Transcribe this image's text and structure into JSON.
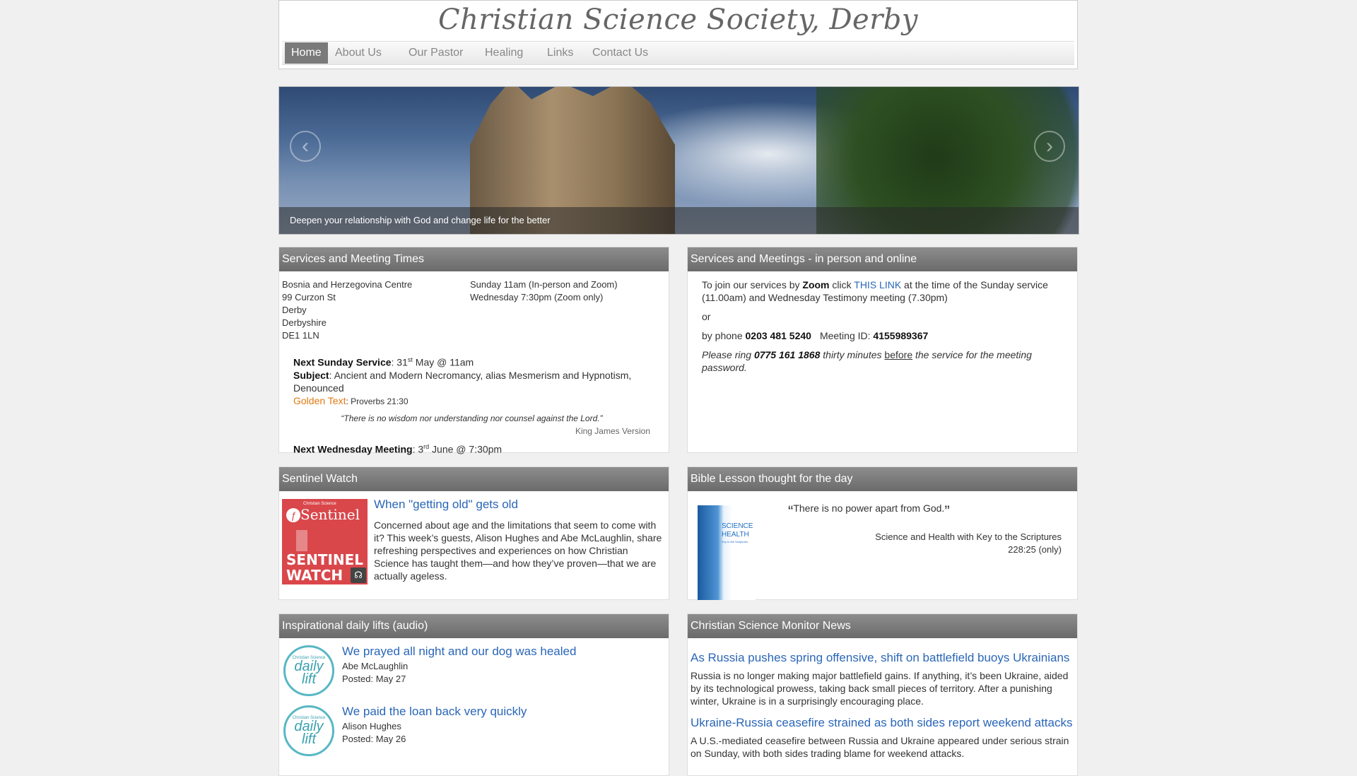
{
  "site": {
    "title": "Christian Science Society, Derby"
  },
  "nav": [
    {
      "label": "Home"
    },
    {
      "label": "About Us"
    },
    {
      "label": "Our Pastor"
    },
    {
      "label": "Healing"
    },
    {
      "label": "Links"
    },
    {
      "label": "Contact Us"
    }
  ],
  "hero": {
    "caption": "Deepen your relationship with God and change life for the better"
  },
  "services_times": {
    "heading": "Services and Meeting Times",
    "address": [
      "Bosnia and Herzegovina Centre",
      "99 Curzon St",
      "Derby",
      "Derbyshire",
      "DE1 1LN"
    ],
    "times": [
      "Sunday 11am (In-person and Zoom)",
      "Wednesday 7:30pm (Zoom only)"
    ],
    "next_sunday_label": "Next Sunday Service",
    "next_sunday_pre": ": 31",
    "next_sunday_sup": "st",
    "next_sunday_post": " May @ 11am",
    "subject_label": "Subject",
    "subject_value": ": Ancient and Modern Necromancy, alias Mesmerism and Hypnotism, Denounced",
    "golden_label": "Golden Text",
    "golden_ref": ": Proverbs 21:30",
    "golden_quote": "“There is no wisdom nor understanding nor counsel against the Lord.”",
    "golden_version": "King James Version",
    "next_wed_label": "Next Wednesday Meeting",
    "next_wed_pre": ": 3",
    "next_wed_sup": "rd",
    "next_wed_post": " June @ 7:30pm"
  },
  "services_online": {
    "heading": "Services and Meetings - in person and online",
    "line1_pre": "To join our services by ",
    "line1_zoom": "Zoom",
    "line1_mid": " click ",
    "line1_link": "THIS LINK",
    "line1_post": " at the time of the Sunday service (11.00am) and Wednesday Testimony meeting (7.30pm)",
    "or": "or",
    "phone_pre": "by phone ",
    "phone_number": "0203 481 5240",
    "meeting_id_label": "Meeting ID: ",
    "meeting_id": "4155989367",
    "ring_pre": "Please ring ",
    "ring_number": "0775 161 1868",
    "ring_mid": " thirty minutes ",
    "ring_before": "before",
    "ring_post": " the service for the meeting password."
  },
  "sentinel": {
    "heading": "Sentinel Watch",
    "thumb_brand": "Christian Science",
    "thumb_title": "Sentinel",
    "thumb_line1": "SENTINEL",
    "thumb_line2": "WATCH",
    "title": "When \"getting old\" gets old",
    "body": "Concerned about age and the limitations that seem to come with it? This week’s guests, Alison Hughes and Abe McLaughlin, share refreshing perspectives and experiences on how Christian Science has taught them—and how they’ve proven—that we are actually ageless."
  },
  "bible_lesson": {
    "heading": "Bible Lesson thought for the day",
    "book_line1": "SCIENCE",
    "book_line2": "HEALTH",
    "book_line3": "Key to the Scriptures",
    "open_quote": "“",
    "quote": "There is no power apart from God.",
    "close_quote": "”",
    "source": "Science and Health with Key to the Scriptures",
    "citation": "228:25 (only)"
  },
  "daily_lifts": {
    "heading": "Inspirational daily lifts (audio)",
    "icon_brand": "Christian Science",
    "icon_word1": "daily",
    "icon_word2": "lift",
    "items": [
      {
        "title": "We prayed all night and our dog was healed",
        "author": "Abe McLaughlin",
        "posted": "Posted: May 27"
      },
      {
        "title": "We paid the loan back very quickly",
        "author": "Alison Hughes",
        "posted": "Posted: May 26"
      }
    ]
  },
  "monitor": {
    "heading": "Christian Science Monitor News",
    "items": [
      {
        "title": "As Russia pushes spring offensive, shift on battlefield buoys Ukrainians",
        "body": "Russia is no longer making major battlefield gains. If anything, it’s been Ukraine, aided by its technological prowess, taking back small pieces of territory. After a punishing winter, Ukraine is in a surprisingly encouraging place."
      },
      {
        "title": "Ukraine-Russia ceasefire strained as both sides report weekend attacks",
        "body": "A U.S.-mediated ceasefire between Russia and Ukraine appeared under serious strain on Sunday, with both sides trading blame for weekend attacks."
      }
    ]
  }
}
